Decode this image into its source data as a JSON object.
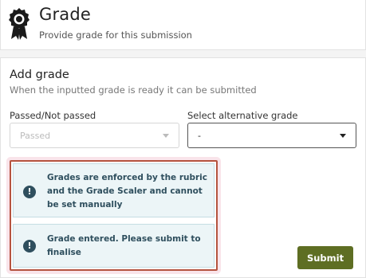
{
  "header": {
    "title": "Grade",
    "subtitle": "Provide grade for this submission",
    "icon": "award-ribbon-icon"
  },
  "add_grade": {
    "title": "Add grade",
    "description": "When the inputted grade is ready it can be submitted",
    "passed_field": {
      "label": "Passed/Not passed",
      "value": "Passed",
      "disabled": true
    },
    "alternative_field": {
      "label": "Select alternative grade",
      "value": "-"
    },
    "alerts": [
      {
        "icon": "exclamation-circle-icon",
        "text": "Grades are enforced by the rubric and the Grade Scaler and cannot be set manually"
      },
      {
        "icon": "exclamation-circle-icon",
        "text": "Grade entered. Please submit to finalise"
      }
    ],
    "submit_label": "Submit"
  },
  "colors": {
    "submit_button": "#5e6e23",
    "alert_background": "#ecf5f7",
    "alert_text": "#2f4f5e",
    "highlight_border": "#b5533f"
  }
}
